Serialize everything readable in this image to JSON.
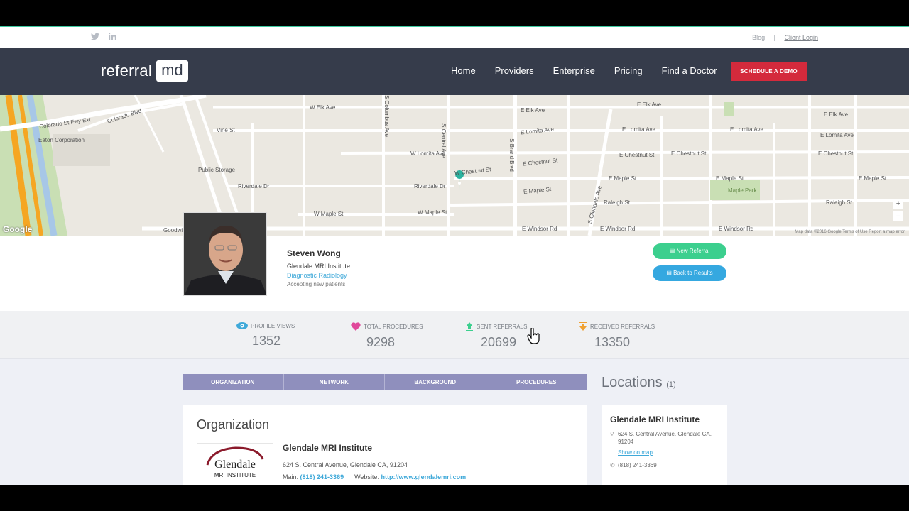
{
  "topbar": {
    "blog": "Blog",
    "separator": "|",
    "login": "Client Login"
  },
  "nav": {
    "logo_word": "referral",
    "logo_box": "md",
    "links": [
      "Home",
      "Providers",
      "Enterprise",
      "Pricing",
      "Find a Doctor"
    ],
    "cta": "SCHEDULE A DEMO"
  },
  "map": {
    "labels": [
      "Colorado St Fwy Ext",
      "Colorado Blvd",
      "Eaton Corporation",
      "Public Storage",
      "Vine St",
      "W Elk Ave",
      "W Lomita Ave",
      "Riverdale Dr",
      "Riverdale Dr",
      "W Maple St",
      "W Maple St",
      "W Chestnut St",
      "E Elk Ave",
      "E Elk Ave",
      "E Elk Ave",
      "E Lomita Ave",
      "E Lomita Ave",
      "E Lomita Ave",
      "E Lomita Ave",
      "E Chestnut St",
      "E Chestnut St",
      "E Chestnut St",
      "E Chestnut St",
      "E Maple St",
      "E Maple St",
      "E Maple St",
      "E Maple St",
      "Raleigh St",
      "Raleigh St",
      "E Windsor Rd",
      "E Windsor Rd",
      "E Windsor Rd",
      "Maple Park",
      "S Columbus Ave",
      "S Central Ave",
      "S Brand Blvd",
      "S Glendale Ave",
      "Goodwin"
    ],
    "google": "Google",
    "credit": "Map data ©2016 Google   Terms of Use   Report a map error",
    "zoom_in": "+",
    "zoom_out": "−"
  },
  "profile": {
    "name": "Steven Wong",
    "organization": "Glendale MRI Institute",
    "specialty": "Diagnostic Radiology",
    "status": "Accepting new patients",
    "new_referral": "New Referral",
    "back": "Back to Results"
  },
  "stats": [
    {
      "label": "PROFILE VIEWS",
      "value": "1352",
      "icon": "eye-icon",
      "color": "#3fa9d9"
    },
    {
      "label": "TOTAL PROCEDURES",
      "value": "9298",
      "icon": "heart-icon",
      "color": "#e0489a"
    },
    {
      "label": "SENT REFERRALS",
      "value": "20699",
      "icon": "arrow-up-icon",
      "color": "#3ccf8e"
    },
    {
      "label": "RECEIVED REFERRALS",
      "value": "13350",
      "icon": "arrow-down-icon",
      "color": "#f0a030"
    }
  ],
  "tabs": [
    "ORGANIZATION",
    "NETWORK",
    "BACKGROUND",
    "PROCEDURES"
  ],
  "organization": {
    "heading": "Organization",
    "logo_top": "Glendale",
    "logo_bottom": "MRI INSTITUTE",
    "name": "Glendale MRI Institute",
    "address": "624 S. Central Avenue, Glendale CA, 91204",
    "main_label": "Main:",
    "main_phone": "(818) 241-3369",
    "website_label": "Website:",
    "website": "http://www.glendalemri.com"
  },
  "locations": {
    "heading": "Locations",
    "count": "(1)",
    "name": "Glendale MRI Institute",
    "address": "624 S. Central Avenue, Glendale CA, 91204",
    "show_map": "Show on map",
    "phone": "(818) 241-3369"
  }
}
